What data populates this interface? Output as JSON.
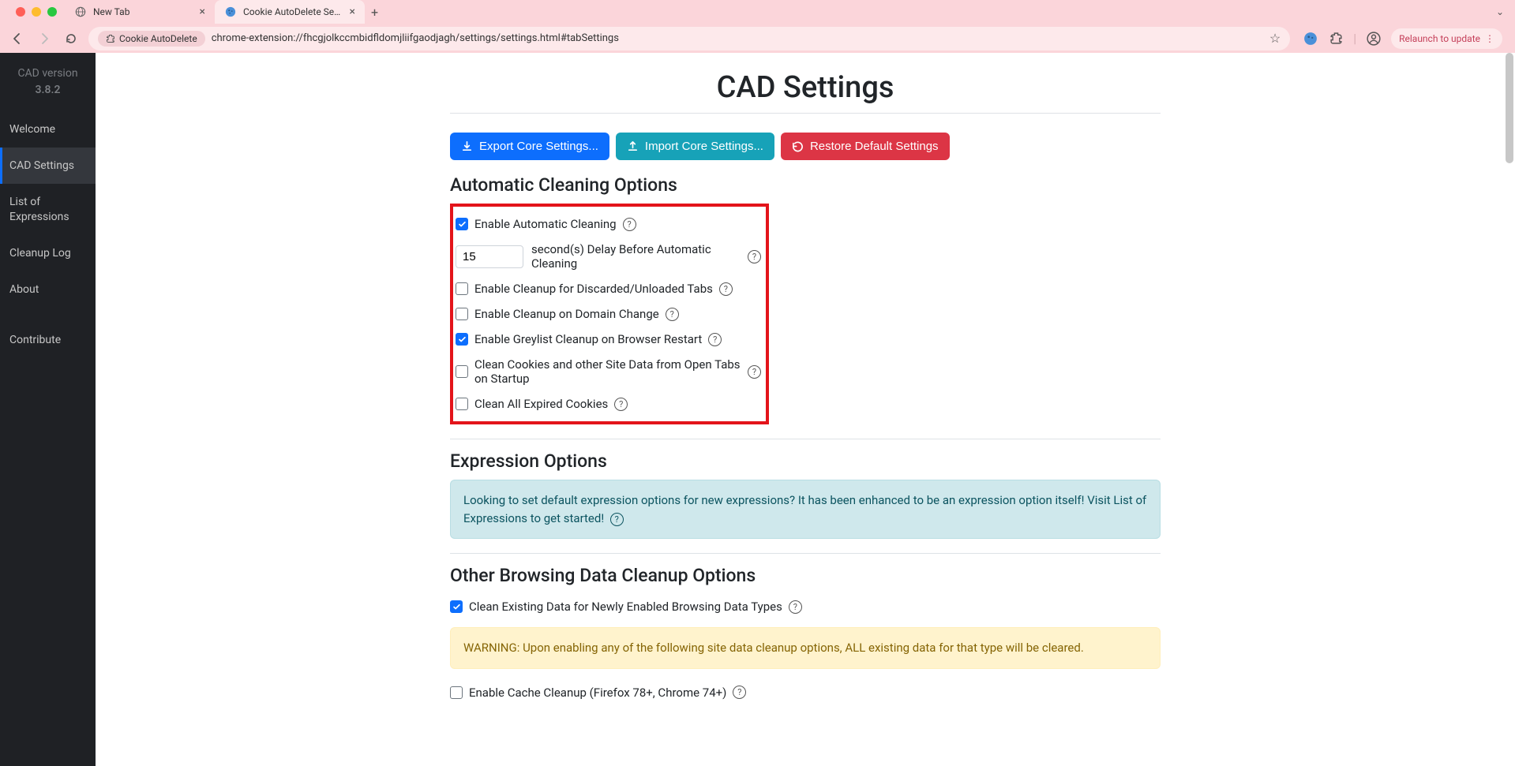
{
  "browser": {
    "tabs": [
      {
        "title": "New Tab",
        "active": false
      },
      {
        "title": "Cookie AutoDelete Settings",
        "active": true
      }
    ],
    "ext_name": "Cookie AutoDelete",
    "url": "chrome-extension://fhcgjolkccmbidfldomjliifgaodjagh/settings/settings.html#tabSettings",
    "relaunch": "Relaunch to update"
  },
  "sidebar": {
    "version_label": "CAD version",
    "version": "3.8.2",
    "items": [
      "Welcome",
      "CAD Settings",
      "List of Expressions",
      "Cleanup Log",
      "About",
      "Contribute"
    ]
  },
  "page": {
    "title": "CAD Settings",
    "buttons": {
      "export": "Export Core Settings...",
      "import": "Import Core Settings...",
      "restore": "Restore Default Settings"
    },
    "auto_section": {
      "heading": "Automatic Cleaning Options",
      "opts": {
        "enable_auto": "Enable Automatic Cleaning",
        "delay_value": "15",
        "delay_label": "second(s) Delay Before Automatic Cleaning",
        "discarded": "Enable Cleanup for Discarded/Unloaded Tabs",
        "domain_change": "Enable Cleanup on Domain Change",
        "greylist": "Enable Greylist Cleanup on Browser Restart",
        "startup": "Clean Cookies and other Site Data from Open Tabs on Startup",
        "expired": "Clean All Expired Cookies"
      }
    },
    "expr_section": {
      "heading": "Expression Options",
      "info": "Looking to set default expression options for new expressions? It has been enhanced to be an expression option itself! Visit List of Expressions to get started!"
    },
    "other_section": {
      "heading": "Other Browsing Data Cleanup Options",
      "clean_existing": "Clean Existing Data for Newly Enabled Browsing Data Types",
      "warning": "WARNING: Upon enabling any of the following site data cleanup options, ALL existing data for that type will be cleared.",
      "cache": "Enable Cache Cleanup (Firefox 78+, Chrome 74+)"
    }
  }
}
